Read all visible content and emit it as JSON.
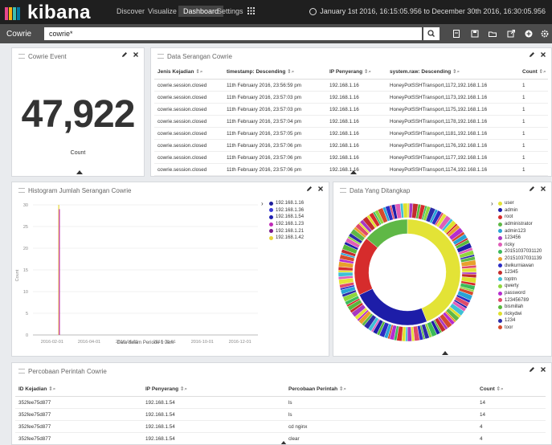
{
  "app": {
    "logo_text": "kibana",
    "logo_colors": [
      "#e8478b",
      "#f9b110",
      "#40beb0",
      "#0079a5"
    ]
  },
  "nav": {
    "links": [
      {
        "label": "Discover",
        "active": false
      },
      {
        "label": "Visualize",
        "active": false
      },
      {
        "label": "Dashboard",
        "active": true
      },
      {
        "label": "Settings",
        "active": false
      }
    ],
    "time_range": "January 1st 2016, 16:15:05.956 to December 30th 2016, 16:30:05.956"
  },
  "search": {
    "index_name": "Cowrie",
    "query": "cowrie*"
  },
  "panels": {
    "cowrie_event": {
      "title": "Cowrie Event",
      "value": "47,922",
      "label": "Count"
    },
    "attacks": {
      "title": "Data Serangan Cowrie",
      "columns": [
        "Jenis Kejadian",
        "timestamp: Descending",
        "IP Penyerang",
        "system.raw: Descending",
        "Count"
      ],
      "rows": [
        [
          "cowrie.session.closed",
          "11th February 2016, 23:56:59 pm",
          "192.168.1.16",
          "HoneyPotSSHTransport,1172,192.168.1.16",
          "1"
        ],
        [
          "cowrie.session.closed",
          "11th February 2016, 23:57:03 pm",
          "192.168.1.16",
          "HoneyPotSSHTransport,1173,192.168.1.16",
          "1"
        ],
        [
          "cowrie.session.closed",
          "11th February 2016, 23:57:03 pm",
          "192.168.1.16",
          "HoneyPotSSHTransport,1175,192.168.1.16",
          "1"
        ],
        [
          "cowrie.session.closed",
          "11th February 2016, 23:57:04 pm",
          "192.168.1.16",
          "HoneyPotSSHTransport,1178,192.168.1.16",
          "1"
        ],
        [
          "cowrie.session.closed",
          "11th February 2016, 23:57:05 pm",
          "192.168.1.16",
          "HoneyPotSSHTransport,1181,192.168.1.16",
          "1"
        ],
        [
          "cowrie.session.closed",
          "11th February 2016, 23:57:06 pm",
          "192.168.1.16",
          "HoneyPotSSHTransport,1176,192.168.1.16",
          "1"
        ],
        [
          "cowrie.session.closed",
          "11th February 2016, 23:57:06 pm",
          "192.168.1.16",
          "HoneyPotSSHTransport,1177,192.168.1.16",
          "1"
        ],
        [
          "cowrie.session.closed",
          "11th February 2016, 23:57:06 pm",
          "192.168.1.16",
          "HoneyPotSSHTransport,1174,192.168.1.16",
          "1"
        ]
      ]
    },
    "histogram": {
      "title": "Histogram Jumlah Serangan Cowrie",
      "legend": [
        {
          "label": "192.168.1.16",
          "color": "#1f1f9c"
        },
        {
          "label": "192.168.1.36",
          "color": "#3b3bd9"
        },
        {
          "label": "192.168.1.54",
          "color": "#2020b0"
        },
        {
          "label": "192.168.1.23",
          "color": "#c02bb7"
        },
        {
          "label": "192.168.1.21",
          "color": "#7a1a8a"
        },
        {
          "label": "192.168.1.42",
          "color": "#e7d53a"
        }
      ]
    },
    "donut": {
      "title": "Data Yang Ditangkap",
      "legend": [
        {
          "label": "user",
          "color": "#e3e336"
        },
        {
          "label": "admin",
          "color": "#1d1da8"
        },
        {
          "label": "root",
          "color": "#d62c2c"
        },
        {
          "label": "administrator",
          "color": "#5fb846"
        },
        {
          "label": "admin123",
          "color": "#29a3d6"
        },
        {
          "label": "123456",
          "color": "#a838c2"
        },
        {
          "label": "ricky",
          "color": "#e05db8"
        },
        {
          "label": "20151037031120",
          "color": "#3cba5a"
        },
        {
          "label": "20151037031139",
          "color": "#e8a02c"
        },
        {
          "label": "dwikurniawan",
          "color": "#2c2cc4"
        },
        {
          "label": "12345",
          "color": "#c42c2c"
        },
        {
          "label": "toptm",
          "color": "#3ec0d6"
        },
        {
          "label": "qwerty",
          "color": "#8fd63c"
        },
        {
          "label": "password",
          "color": "#b62ccf"
        },
        {
          "label": "123456789",
          "color": "#e04a6a"
        },
        {
          "label": "bismillah",
          "color": "#58b83c"
        },
        {
          "label": "rickydwi",
          "color": "#e0e02c"
        },
        {
          "label": "1234",
          "color": "#2c2ca8"
        },
        {
          "label": "toor",
          "color": "#d64a2c"
        }
      ]
    },
    "commands": {
      "title": "Percobaan Perintah Cowrie",
      "columns": [
        "ID Kejadian",
        "IP Penyerang",
        "Percobaan Perintah",
        "Count"
      ],
      "rows": [
        [
          "352fee75d877",
          "192.168.1.54",
          "ls",
          "14"
        ],
        [
          "352fee75d877",
          "192.168.1.54",
          "ls",
          "14"
        ],
        [
          "352fee75d877",
          "192.168.1.54",
          "cd nginx",
          "4"
        ],
        [
          "352fee75d877",
          "192.168.1.54",
          "clear",
          "4"
        ]
      ]
    }
  },
  "chart_data": {
    "type": "bar",
    "title": "",
    "xlabel": "Data dalam Periode 1 Jam",
    "ylabel": "Count",
    "ylim": [
      0,
      30
    ],
    "yticks": [
      0,
      5,
      10,
      15,
      20,
      25,
      30
    ],
    "xticks": [
      "2016-02-01",
      "2016-04-01",
      "2016-06-01",
      "2016-08-01",
      "2016-10-01",
      "2016-12-01"
    ],
    "xlim": [
      "2016-01-01",
      "2016-12-30"
    ],
    "bars": [
      {
        "x": "2016-02-11",
        "value": 30,
        "color": "#e7d53a"
      },
      {
        "x": "2016-02-12",
        "value": 29,
        "color": "#c02bb7"
      }
    ],
    "series": [
      {
        "name": "192.168.1.16"
      },
      {
        "name": "192.168.1.36"
      },
      {
        "name": "192.168.1.54"
      },
      {
        "name": "192.168.1.23"
      },
      {
        "name": "192.168.1.21"
      },
      {
        "name": "192.168.1.42"
      }
    ]
  }
}
